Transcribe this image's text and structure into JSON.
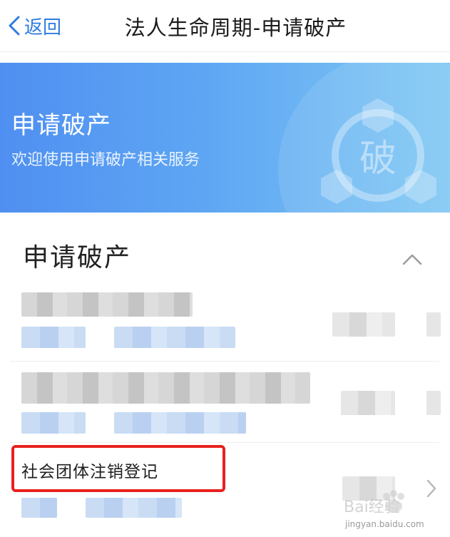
{
  "nav": {
    "back_label": "返回",
    "title": "法人生命周期-申请破产"
  },
  "banner": {
    "title": "申请破产",
    "subtitle": "欢迎使用申请破产相关服务",
    "emblem_char": "破"
  },
  "section": {
    "title": "申请破产",
    "items": [
      {
        "title": "社会团体注销登记"
      }
    ]
  },
  "watermark": {
    "logo_text": "Bai经验",
    "url_text": "jingyan.baidu.com"
  },
  "colors": {
    "accent": "#2f7ce0",
    "banner_start": "#4f8ff1",
    "banner_end": "#7fc8f3",
    "highlight": "#e8211f"
  },
  "icons": {
    "back": "chevron-left-icon",
    "collapse": "chevron-up-icon",
    "item_arrow": "chevron-right-icon"
  }
}
